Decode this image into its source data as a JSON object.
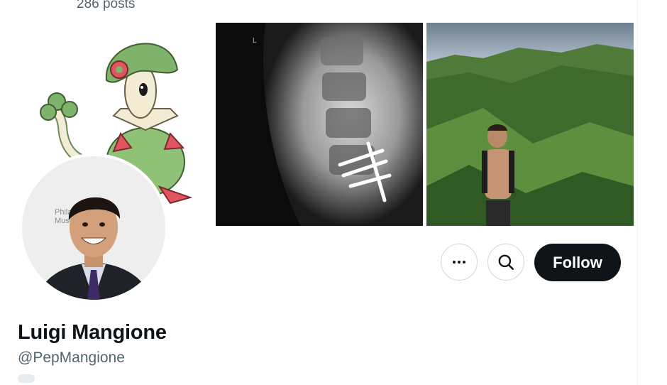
{
  "profile": {
    "post_count": "286 posts",
    "display_name": "Luigi Mangione",
    "handle": "@PepMangione"
  },
  "banner": {
    "art_subject": "pokemon-artwork",
    "xray_subject": "spine-xray",
    "photo_subject": "hiking-photo"
  },
  "avatar": {
    "backdrop_text": "Philad\nMuse"
  },
  "actions": {
    "more_icon": "more-horizontal-icon",
    "search_icon": "search-icon",
    "follow_label": "Follow"
  },
  "colors": {
    "primary_text": "#0f1419",
    "secondary_text": "#536471",
    "follow_bg": "#0f1419",
    "follow_text": "#ffffff",
    "border": "#cfd9de"
  }
}
